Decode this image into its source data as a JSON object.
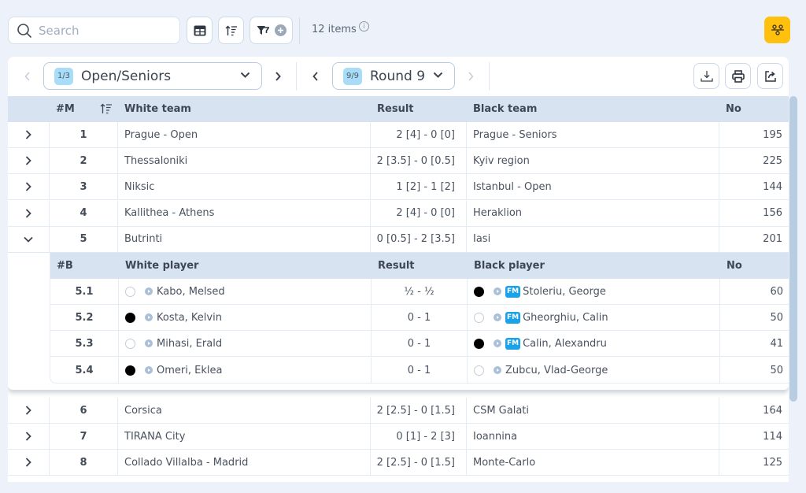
{
  "toolbar": {
    "search_placeholder": "Search",
    "search_value": "",
    "items_count": "12 items",
    "info_glyph": "i",
    "buttons": [
      "table-view",
      "sort",
      "filter-add"
    ],
    "accent_color": "#ffc10e"
  },
  "nav": {
    "group": {
      "badge": "1/3",
      "label": "Open/Seniors"
    },
    "round": {
      "badge": "9/9",
      "label": "Round 9"
    },
    "actions": [
      "download",
      "print",
      "share"
    ]
  },
  "table": {
    "headers": {
      "match": "#M",
      "white": "White team",
      "result": "Result",
      "black": "Black team",
      "no": "No"
    },
    "rows": [
      {
        "m": "1",
        "white": "Prague - Open",
        "result": "2 [4] - 0 [0]",
        "black": "Prague - Seniors",
        "no": "195",
        "expanded": false
      },
      {
        "m": "2",
        "white": "Thessaloniki",
        "result": "2 [3.5] - 0 [0.5]",
        "black": "Kyiv region",
        "no": "225",
        "expanded": false
      },
      {
        "m": "3",
        "white": "Niksic",
        "result": "1 [2] - 1 [2]",
        "black": "Istanbul - Open",
        "no": "144",
        "expanded": false
      },
      {
        "m": "4",
        "white": "Kallithea - Athens",
        "result": "2 [4] - 0 [0]",
        "black": "Heraklion",
        "no": "156",
        "expanded": false
      },
      {
        "m": "5",
        "white": "Butrinti",
        "result": "0 [0.5] - 2 [3.5]",
        "black": "Iasi",
        "no": "201",
        "expanded": true
      },
      {
        "m": "6",
        "white": "Corsica",
        "result": "2 [2.5] - 0 [1.5]",
        "black": "CSM Galati",
        "no": "164",
        "expanded": false
      },
      {
        "m": "7",
        "white": "TIRANA City",
        "result": "0 [1] - 2 [3]",
        "black": "Ioannina",
        "no": "114",
        "expanded": false
      },
      {
        "m": "8",
        "white": "Collado Villalba - Madrid",
        "result": "2 [2.5] - 0 [1.5]",
        "black": "Monte-Carlo",
        "no": "125",
        "expanded": false
      }
    ],
    "nested": {
      "headers": {
        "board": "#B",
        "white": "White player",
        "result": "Result",
        "black": "Black player",
        "no": "No"
      },
      "rows": [
        {
          "b": "5.1",
          "white_color": "white",
          "white": "Kabo, Melsed",
          "white_title": "",
          "result": "½ - ½",
          "black_color": "black",
          "black_title": "FM",
          "black": "Stoleriu, George",
          "no": "60"
        },
        {
          "b": "5.2",
          "white_color": "black",
          "white": "Kosta, Kelvin",
          "white_title": "",
          "result": "0 - 1",
          "black_color": "white",
          "black_title": "FM",
          "black": "Gheorghiu, Calin",
          "no": "50"
        },
        {
          "b": "5.3",
          "white_color": "white",
          "white": "Mihasi, Erald",
          "white_title": "",
          "result": "0 - 1",
          "black_color": "black",
          "black_title": "FM",
          "black": "Calin, Alexandru",
          "no": "41"
        },
        {
          "b": "5.4",
          "white_color": "black",
          "white": "Omeri, Eklea",
          "white_title": "",
          "result": "0 - 1",
          "black_color": "white",
          "black_title": "",
          "black": "Zubcu, Vlad-George",
          "no": "50"
        }
      ]
    }
  }
}
